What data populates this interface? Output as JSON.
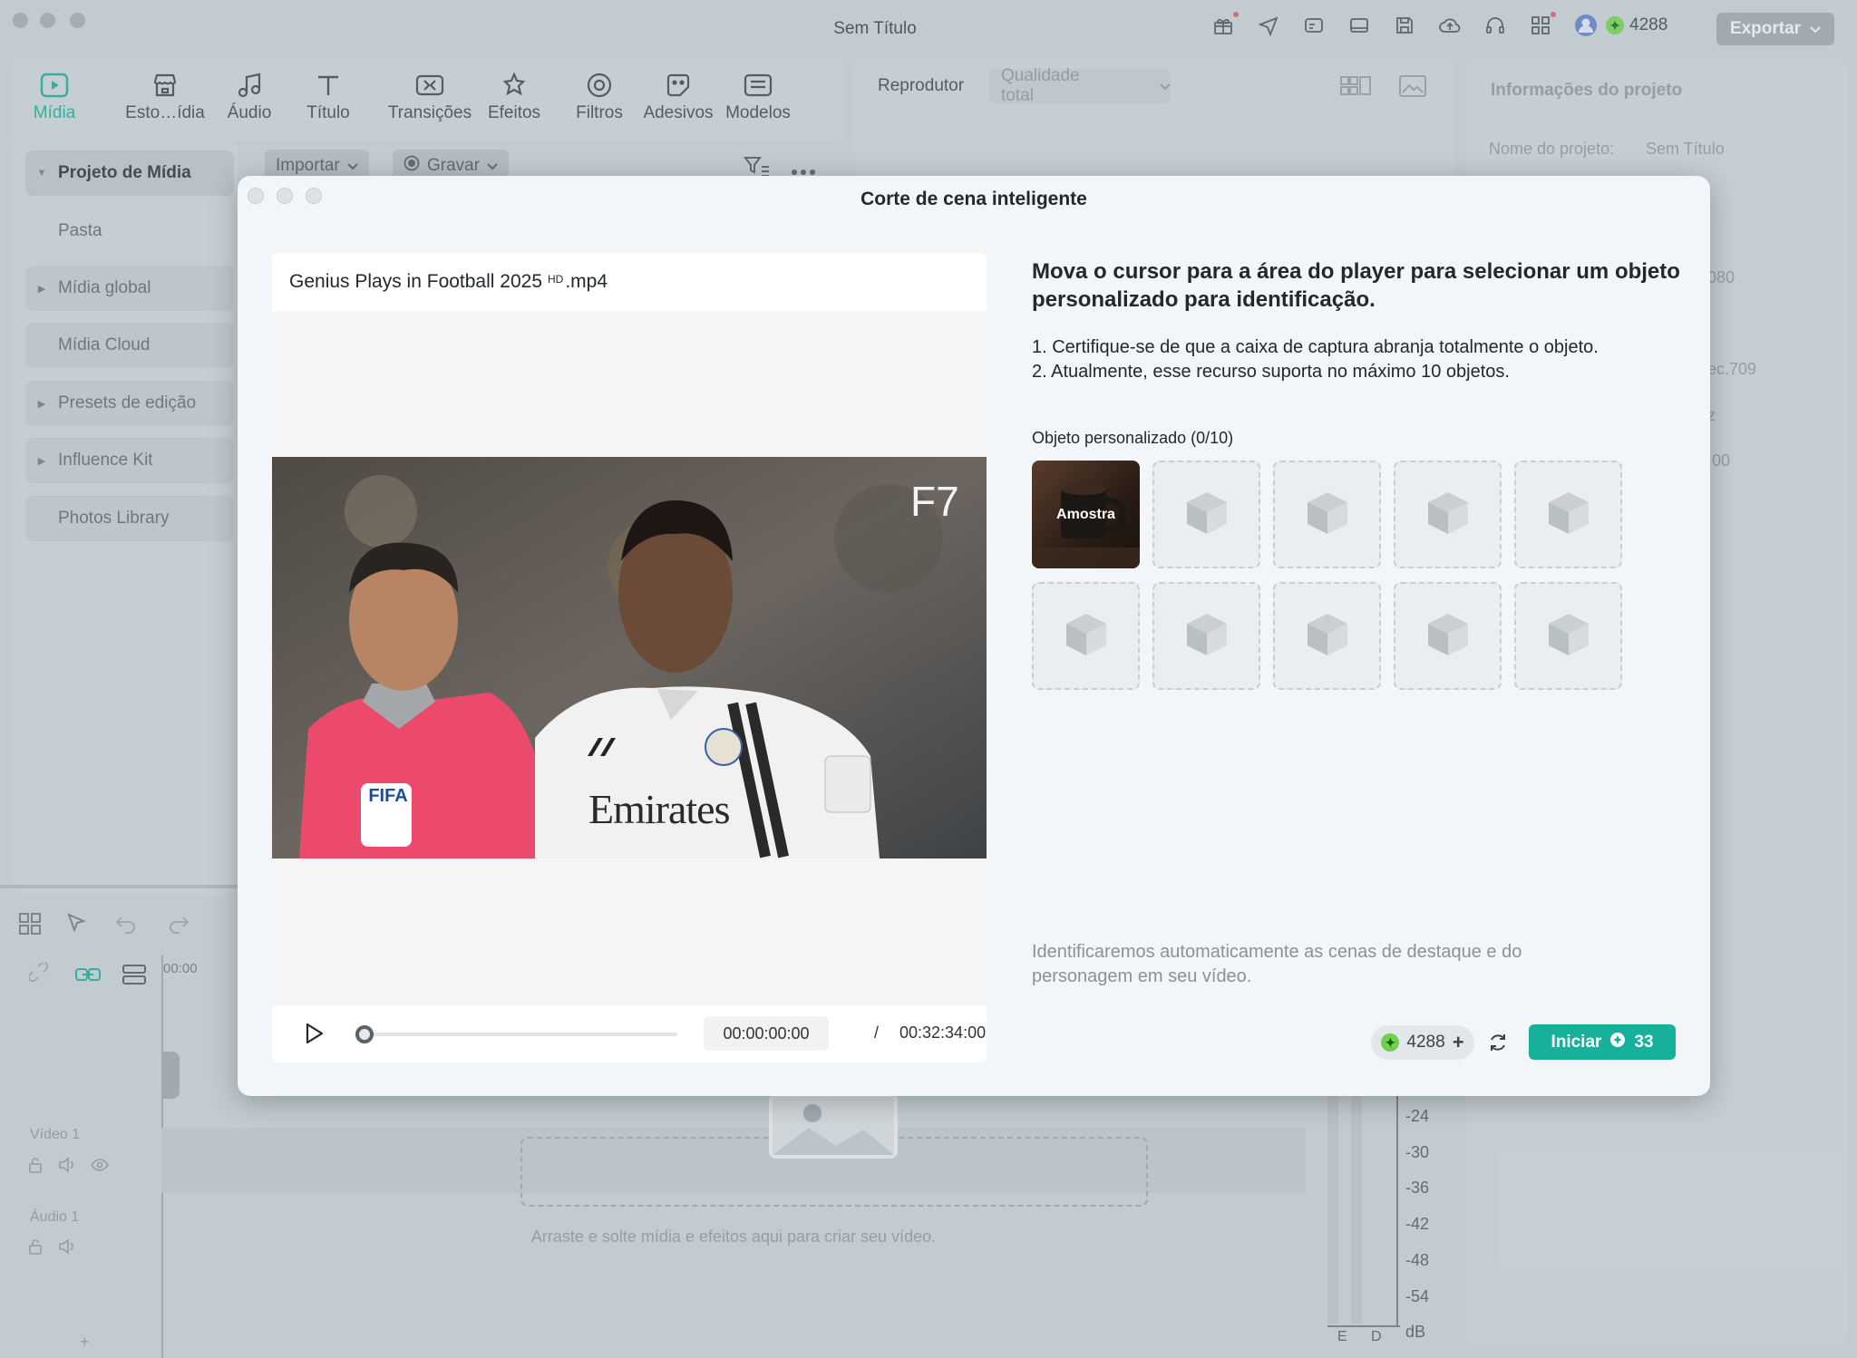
{
  "app": {
    "window_title": "Sem Título",
    "credits": "4288",
    "export_label": "Exportar"
  },
  "media_tabs": [
    {
      "label": "Mídia",
      "icon": "media-icon"
    },
    {
      "label": "Esto…ídia",
      "icon": "store-icon"
    },
    {
      "label": "Áudio",
      "icon": "music-note-icon"
    },
    {
      "label": "Título",
      "icon": "title-text-icon"
    },
    {
      "label": "Transições",
      "icon": "transition-icon"
    },
    {
      "label": "Efeitos",
      "icon": "effects-icon"
    },
    {
      "label": "Filtros",
      "icon": "filter-icon"
    },
    {
      "label": "Adesivos",
      "icon": "sticker-icon"
    },
    {
      "label": "Modelos",
      "icon": "template-icon"
    }
  ],
  "sidebar": {
    "items": [
      {
        "label": "Projeto de Mídia"
      },
      {
        "label": "Pasta"
      },
      {
        "label": "Mídia global"
      },
      {
        "label": "Mídia Cloud"
      },
      {
        "label": "Presets de edição"
      },
      {
        "label": "Influence Kit"
      },
      {
        "label": "Photos Library"
      }
    ]
  },
  "media_toolbar": {
    "import_label": "Importar",
    "record_label": "Gravar"
  },
  "player": {
    "label": "Reprodutor",
    "quality": "Qualidade total"
  },
  "info_panel": {
    "title": "Informações do projeto",
    "name_label": "Nome do projeto:",
    "name_value": "Sem Título",
    "resolution_fragment": "080",
    "colorspace_fragment": "ec.709",
    "fps_fragment": "z",
    "duration_fragment": ":00"
  },
  "timeline": {
    "ruler_time": "00:00",
    "video_track": "Vídeo 1",
    "audio_track": "Áudio 1",
    "drop_hint": "Arraste e solte mídia e efeitos aqui para criar seu vídeo.",
    "vu_scale": [
      "-24",
      "-30",
      "-36",
      "-42",
      "-48",
      "-54",
      "dB"
    ],
    "vu_channels": [
      "E",
      "D"
    ]
  },
  "dialog": {
    "title": "Corte de cena inteligente",
    "file_name": "Genius Plays in Football 2025",
    "file_badge": "HD",
    "file_ext": ".mp4",
    "video_watermark": "F7",
    "current_time": "00:00:00:00",
    "separator": "/",
    "total_time": "00:32:34:00",
    "instruction_title": "Mova o cursor para a área do player para selecionar um objeto personalizado para identificação.",
    "tips": [
      "1. Certifique-se de que a caixa de captura abranja totalmente o objeto.",
      "2. Atualmente, esse recurso suporta no máximo 10 objetos."
    ],
    "objects_label": "Objeto personalizado (0/10)",
    "sample_label": "Amostra",
    "empty_slots": 9,
    "note": "Identificaremos automaticamente as cenas de destaque e do personagem em seu vídeo.",
    "credits": "4288",
    "start_label": "Iniciar",
    "start_cost": "33",
    "accent": "#16b09b"
  }
}
